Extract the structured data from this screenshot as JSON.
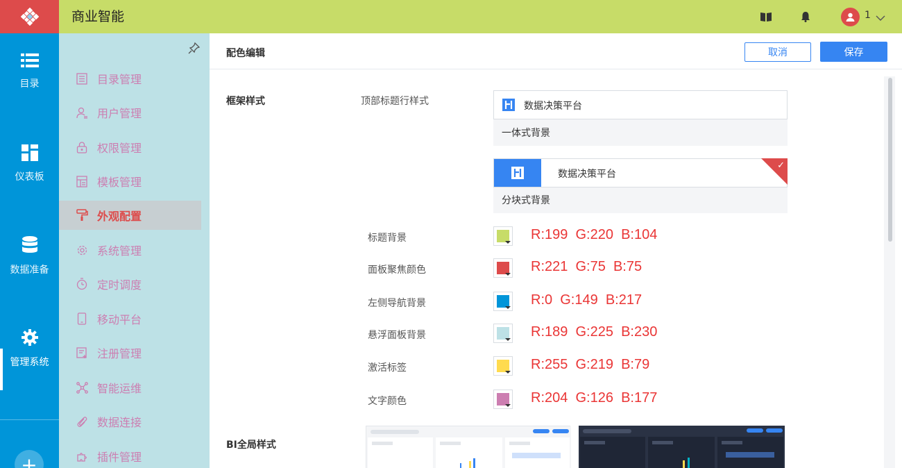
{
  "header": {
    "app_title": "商业智能",
    "user_name": "1",
    "brand_color": "#c7dc68",
    "logo_bg": "#dd4b4b"
  },
  "leftnav": {
    "items": [
      {
        "label": "目录",
        "icon": "list-icon"
      },
      {
        "label": "仪表板",
        "icon": "dashboard-icon"
      },
      {
        "label": "数据准备",
        "icon": "database-icon"
      },
      {
        "label": "管理系统",
        "icon": "gear-icon",
        "active": true
      }
    ],
    "bg": "#0095d9"
  },
  "subnav": {
    "items": [
      {
        "label": "目录管理",
        "icon": "catalog-icon"
      },
      {
        "label": "用户管理",
        "icon": "user-icon"
      },
      {
        "label": "权限管理",
        "icon": "lock-icon"
      },
      {
        "label": "模板管理",
        "icon": "template-icon"
      },
      {
        "label": "外观配置",
        "icon": "paint-roller-icon",
        "active": true
      },
      {
        "label": "系统管理",
        "icon": "gear-outline-icon"
      },
      {
        "label": "定时调度",
        "icon": "timer-icon"
      },
      {
        "label": "移动平台",
        "icon": "mobile-icon"
      },
      {
        "label": "注册管理",
        "icon": "register-icon"
      },
      {
        "label": "智能运维",
        "icon": "network-icon"
      },
      {
        "label": "数据连接",
        "icon": "link-icon"
      },
      {
        "label": "插件管理",
        "icon": "plugin-icon"
      }
    ],
    "bg": "#bde1e6"
  },
  "main": {
    "title": "配色编辑",
    "cancel_label": "取消",
    "save_label": "保存",
    "frame_section": "框架样式",
    "top_title_style_label": "顶部标题行样式",
    "theme_options": [
      {
        "bar_title": "数据决策平台",
        "caption": "一体式背景",
        "selected": false
      },
      {
        "bar_title": "数据决策平台",
        "caption": "分块式背景",
        "selected": true
      }
    ],
    "colors": [
      {
        "label": "标题背景",
        "hex": "#c7dc68",
        "rgb_text": "R:199  G:220  B:104"
      },
      {
        "label": "面板聚焦颜色",
        "hex": "#dd4b4b",
        "rgb_text": "R:221  G:75  B:75"
      },
      {
        "label": "左侧导航背景",
        "hex": "#0095d9",
        "rgb_text": "R:0  G:149  B:217"
      },
      {
        "label": "悬浮面板背景",
        "hex": "#bde1e6",
        "rgb_text": "R:189  G:225  B:230"
      },
      {
        "label": "激活标签",
        "hex": "#ffdb4f",
        "rgb_text": "R:255  G:219  B:79"
      },
      {
        "label": "文字颜色",
        "hex": "#cc7eb1",
        "rgb_text": "R:204  G:126  B:177"
      }
    ],
    "bi_section": "BI全局样式"
  }
}
